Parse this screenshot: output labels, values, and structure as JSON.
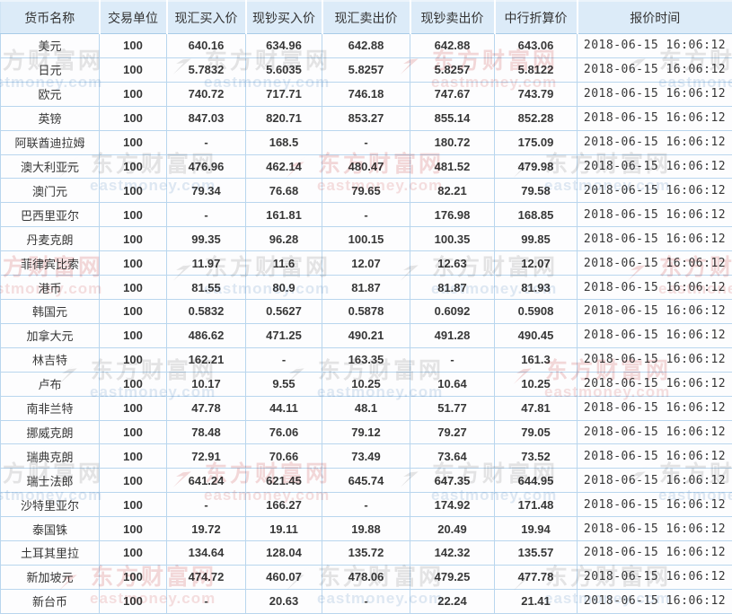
{
  "watermark": {
    "brand_cn": "东方财富网",
    "brand_en": "eastmoney.com"
  },
  "colors": {
    "header_bg": "#dcebf8",
    "grid_border": "#b9d6ee",
    "text": "#373737",
    "watermark_gray": "#e5e5e5",
    "watermark_pink": "#f4d9d9"
  },
  "table": {
    "columns": [
      "货币名称",
      "交易单位",
      "现汇买入价",
      "现钞买入价",
      "现汇卖出价",
      "现钞卖出价",
      "中行折算价",
      "报价时间"
    ],
    "rows": [
      [
        "美元",
        "100",
        "640.16",
        "634.96",
        "642.88",
        "642.88",
        "643.06",
        "2018-06-15 16:06:12"
      ],
      [
        "日元",
        "100",
        "5.7832",
        "5.6035",
        "5.8257",
        "5.8257",
        "5.8122",
        "2018-06-15 16:06:12"
      ],
      [
        "欧元",
        "100",
        "740.72",
        "717.71",
        "746.18",
        "747.67",
        "743.79",
        "2018-06-15 16:06:12"
      ],
      [
        "英镑",
        "100",
        "847.03",
        "820.71",
        "853.27",
        "855.14",
        "852.28",
        "2018-06-15 16:06:12"
      ],
      [
        "阿联酋迪拉姆",
        "100",
        "-",
        "168.5",
        "-",
        "180.72",
        "175.09",
        "2018-06-15 16:06:12"
      ],
      [
        "澳大利亚元",
        "100",
        "476.96",
        "462.14",
        "480.47",
        "481.52",
        "479.98",
        "2018-06-15 16:06:12"
      ],
      [
        "澳门元",
        "100",
        "79.34",
        "76.68",
        "79.65",
        "82.21",
        "79.58",
        "2018-06-15 16:06:12"
      ],
      [
        "巴西里亚尔",
        "100",
        "-",
        "161.81",
        "-",
        "176.98",
        "168.85",
        "2018-06-15 16:06:12"
      ],
      [
        "丹麦克朗",
        "100",
        "99.35",
        "96.28",
        "100.15",
        "100.35",
        "99.85",
        "2018-06-15 16:06:12"
      ],
      [
        "菲律宾比索",
        "100",
        "11.97",
        "11.6",
        "12.07",
        "12.63",
        "12.07",
        "2018-06-15 16:06:12"
      ],
      [
        "港币",
        "100",
        "81.55",
        "80.9",
        "81.87",
        "81.87",
        "81.93",
        "2018-06-15 16:06:12"
      ],
      [
        "韩国元",
        "100",
        "0.5832",
        "0.5627",
        "0.5878",
        "0.6092",
        "0.5908",
        "2018-06-15 16:06:12"
      ],
      [
        "加拿大元",
        "100",
        "486.62",
        "471.25",
        "490.21",
        "491.28",
        "490.45",
        "2018-06-15 16:06:12"
      ],
      [
        "林吉特",
        "100",
        "162.21",
        "-",
        "163.35",
        "-",
        "161.3",
        "2018-06-15 16:06:12"
      ],
      [
        "卢布",
        "100",
        "10.17",
        "9.55",
        "10.25",
        "10.64",
        "10.25",
        "2018-06-15 16:06:12"
      ],
      [
        "南非兰特",
        "100",
        "47.78",
        "44.11",
        "48.1",
        "51.77",
        "47.81",
        "2018-06-15 16:06:12"
      ],
      [
        "挪威克朗",
        "100",
        "78.48",
        "76.06",
        "79.12",
        "79.27",
        "79.05",
        "2018-06-15 16:06:12"
      ],
      [
        "瑞典克朗",
        "100",
        "72.91",
        "70.66",
        "73.49",
        "73.64",
        "73.52",
        "2018-06-15 16:06:12"
      ],
      [
        "瑞士法郎",
        "100",
        "641.24",
        "621.45",
        "645.74",
        "647.35",
        "644.95",
        "2018-06-15 16:06:12"
      ],
      [
        "沙特里亚尔",
        "100",
        "-",
        "166.27",
        "-",
        "174.92",
        "171.48",
        "2018-06-15 16:06:12"
      ],
      [
        "泰国铢",
        "100",
        "19.72",
        "19.11",
        "19.88",
        "20.49",
        "19.94",
        "2018-06-15 16:06:12"
      ],
      [
        "土耳其里拉",
        "100",
        "134.64",
        "128.04",
        "135.72",
        "142.32",
        "135.57",
        "2018-06-15 16:06:12"
      ],
      [
        "新加坡元",
        "100",
        "474.72",
        "460.07",
        "478.06",
        "479.25",
        "477.78",
        "2018-06-15 16:06:12"
      ],
      [
        "新台币",
        "100",
        "-",
        "20.63",
        "-",
        "22.24",
        "21.41",
        "2018-06-15 16:06:12"
      ]
    ]
  }
}
